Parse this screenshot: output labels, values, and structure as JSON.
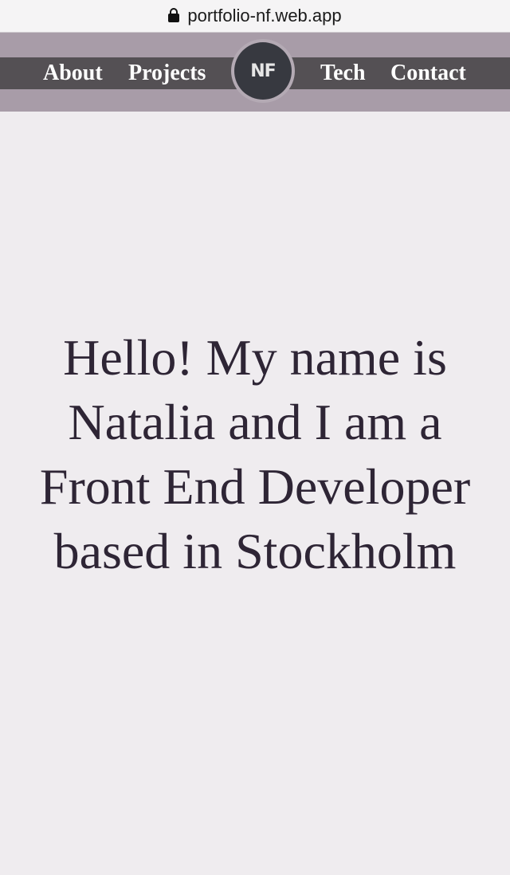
{
  "browser": {
    "url": "portfolio-nf.web.app"
  },
  "nav": {
    "links": [
      {
        "label": "About"
      },
      {
        "label": "Projects"
      },
      {
        "label": "Tech"
      },
      {
        "label": "Contact"
      }
    ],
    "logo_text": "NF"
  },
  "hero": {
    "text": "Hello! My name is Natalia and I am a Front End Developer based in Stockholm"
  }
}
